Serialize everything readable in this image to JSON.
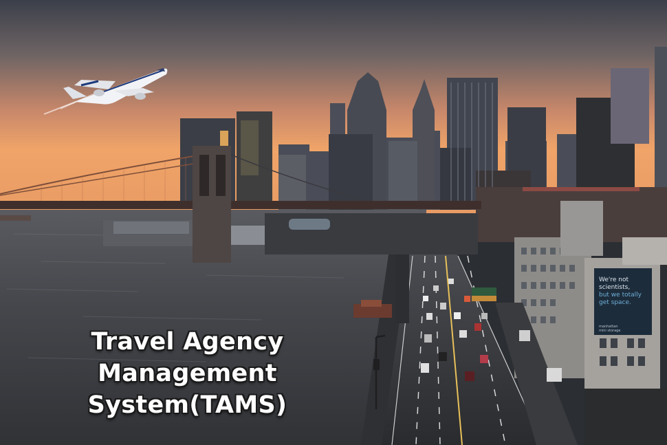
{
  "title": {
    "line1": "Travel Agency Management",
    "line2": "System(TAMS)"
  },
  "billboard": {
    "line1": "We're not",
    "line2": "scientists,",
    "line3": "but we totally",
    "line4": "get space.",
    "brand1": "manhattan",
    "brand2": "mini storage"
  },
  "colors": {
    "sky_top": "#3a3d48",
    "sky_horizon": "#f0a468",
    "water": "#3c3f44",
    "title_text": "#ffffff"
  },
  "icons": {
    "airplane": "airplane-icon"
  }
}
